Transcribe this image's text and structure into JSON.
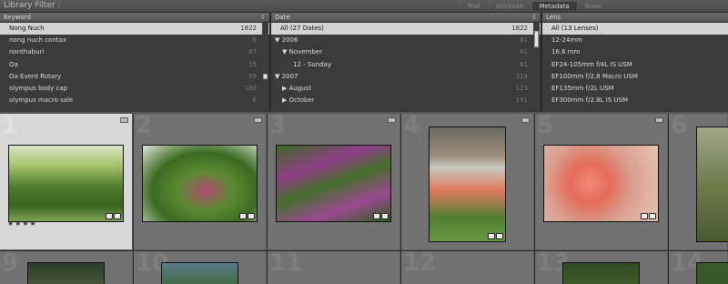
{
  "filter_bar": {
    "title": "Library Filter :",
    "modes": [
      "Text",
      "Attribute",
      "Metadata",
      "None"
    ],
    "active_mode": "Metadata"
  },
  "columns": {
    "keyword": {
      "header": "Keyword",
      "rows": [
        {
          "label": "Nong Nuch",
          "count": "1822",
          "selected": true
        },
        {
          "label": "nong nuch contax",
          "count": "6"
        },
        {
          "label": "nonthaburi",
          "count": "67"
        },
        {
          "label": "Oa",
          "count": "19"
        },
        {
          "label": "Oa Event Rotary",
          "count": "89"
        },
        {
          "label": "olympus body cap",
          "count": "180"
        },
        {
          "label": "olympus macro sale",
          "count": "6"
        }
      ]
    },
    "date": {
      "header": "Date",
      "rows": [
        {
          "label": "All (27 Dates)",
          "count": "1822",
          "selected": true
        },
        {
          "label": "▼ 2006",
          "count": "81"
        },
        {
          "label": "▼ November",
          "count": "81"
        },
        {
          "label": "12 - Sunday",
          "count": "81"
        },
        {
          "label": "▼ 2007",
          "count": "314"
        },
        {
          "label": "▶ August",
          "count": "123"
        },
        {
          "label": "▶ October",
          "count": "191"
        }
      ]
    },
    "lens": {
      "header": "Lens",
      "rows": [
        {
          "label": "All (13 Lenses)",
          "selected": true
        },
        {
          "label": "12-24mm"
        },
        {
          "label": "16.6 mm"
        },
        {
          "label": "EF24-105mm f/4L IS USM"
        },
        {
          "label": "EF100mm f/2.8 Macro USM"
        },
        {
          "label": "EF135mm f/2L USM"
        },
        {
          "label": "EF300mm f/2.8L IS USM"
        }
      ]
    }
  },
  "grid": {
    "cells": [
      {
        "index": "1",
        "selected": true,
        "rating": "★★★★"
      },
      {
        "index": "2"
      },
      {
        "index": "3"
      },
      {
        "index": "4"
      },
      {
        "index": "5"
      },
      {
        "index": "6"
      },
      {
        "index": "9"
      },
      {
        "index": "10"
      },
      {
        "index": "11"
      },
      {
        "index": "12"
      },
      {
        "index": "13"
      },
      {
        "index": "14"
      }
    ]
  }
}
